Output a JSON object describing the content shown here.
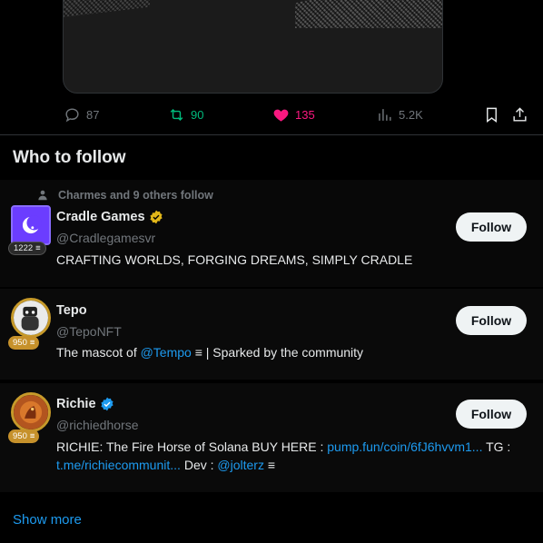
{
  "tweet_actions": {
    "reply_count": "87",
    "retweet_count": "90",
    "like_count": "135",
    "views_count": "5.2K"
  },
  "who_to_follow": {
    "title": "Who to follow",
    "show_more": "Show more",
    "follow_label": "Follow",
    "accounts": [
      {
        "social_context": "Charmes and 9 others follow",
        "name": "Cradle Games",
        "handle": "@Cradlegamesvr",
        "badge": "1222",
        "verified": "gold",
        "bio": "CRAFTING WORLDS, FORGING DREAMS, SIMPLY CRADLE"
      },
      {
        "name": "Tepo",
        "handle": "@TepoNFT",
        "badge": "950",
        "bio_prefix": "The mascot of ",
        "bio_link": "@Tempo",
        "bio_suffix": "| Sparked by the community"
      },
      {
        "name": "Richie",
        "handle": "@richiedhorse",
        "badge": "950",
        "verified": "blue",
        "bio_part1": "RICHIE: The Fire Horse of Solana BUY HERE : ",
        "bio_link1": "pump.fun/coin/6fJ6hvvm1...",
        "bio_part2": " TG : ",
        "bio_link2": "t.me/richiecommunit...",
        "bio_part3": " Dev : ",
        "bio_link3": "@jolterz"
      }
    ]
  },
  "colors": {
    "background": "#000000",
    "accent_blue": "#1d9bf0",
    "like_pink": "#f91880",
    "retweet_green": "#00ba7c",
    "muted": "#71767b"
  }
}
